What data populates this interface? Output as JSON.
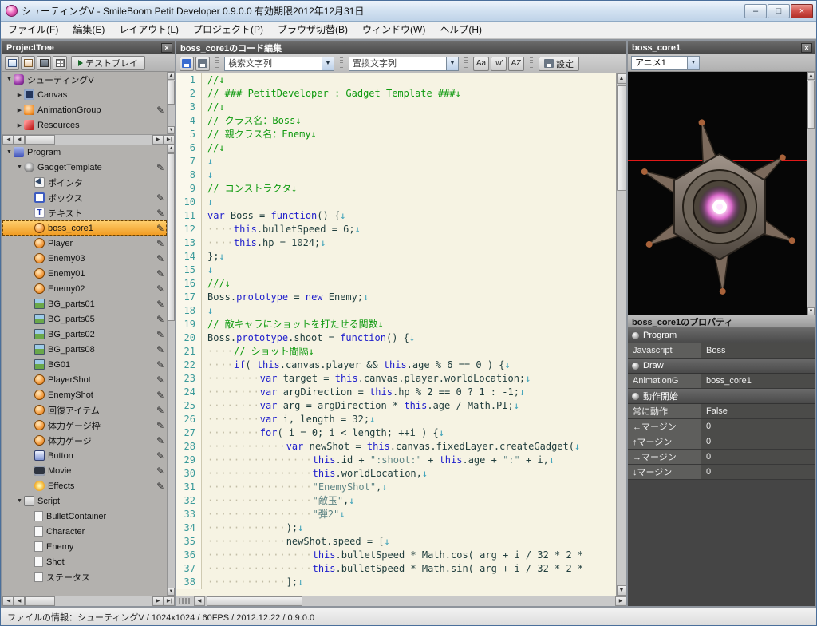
{
  "window": {
    "title": "シューティングV - SmileBoom Petit Developer 0.9.0.0 有効期限2012年12月31日",
    "controls": {
      "minimize": "–",
      "maximize": "□",
      "close": "×"
    }
  },
  "menu": {
    "items": [
      "ファイル(F)",
      "編集(E)",
      "レイアウト(L)",
      "プロジェクト(P)",
      "ブラウザ切替(B)",
      "ウィンドウ(W)",
      "ヘルプ(H)"
    ]
  },
  "project_tree": {
    "title": "ProjectTree",
    "testplay_label": "テストプレイ",
    "tree1": [
      {
        "label": "シューティングV",
        "icon": "app-icon",
        "depth": 0,
        "expander": "expanded"
      },
      {
        "label": "Canvas",
        "icon": "canvas-icon",
        "depth": 1,
        "expander": "collapsed"
      },
      {
        "label": "AnimationGroup",
        "icon": "animation-icon",
        "depth": 1,
        "expander": "collapsed",
        "pencil": true
      },
      {
        "label": "Resources",
        "icon": "resources-icon",
        "depth": 1,
        "expander": "collapsed"
      }
    ],
    "tree2": [
      {
        "label": "Program",
        "icon": "program-icon",
        "depth": 0,
        "expander": "expanded"
      },
      {
        "label": "GadgetTemplate",
        "icon": "gear-icon",
        "depth": 1,
        "expander": "expanded",
        "pencil": true
      },
      {
        "label": "ポインタ",
        "icon": "pointer-icon",
        "depth": 2
      },
      {
        "label": "ボックス",
        "icon": "box-icon",
        "depth": 2,
        "pencil": true
      },
      {
        "label": "テキスト",
        "icon": "text-icon",
        "depth": 2,
        "pencil": true
      },
      {
        "label": "boss_core1",
        "icon": "gadget-icon",
        "depth": 2,
        "pencil": true,
        "selected": true
      },
      {
        "label": "Player",
        "icon": "gadget-icon",
        "depth": 2,
        "pencil": true
      },
      {
        "label": "Enemy03",
        "icon": "gadget-icon",
        "depth": 2,
        "pencil": true
      },
      {
        "label": "Enemy01",
        "icon": "gadget-icon",
        "depth": 2,
        "pencil": true
      },
      {
        "label": "Enemy02",
        "icon": "gadget-icon",
        "depth": 2,
        "pencil": true
      },
      {
        "label": "BG_parts01",
        "icon": "image-icon",
        "depth": 2,
        "pencil": true
      },
      {
        "label": "BG_parts05",
        "icon": "image-icon",
        "depth": 2,
        "pencil": true
      },
      {
        "label": "BG_parts02",
        "icon": "image-icon",
        "depth": 2,
        "pencil": true
      },
      {
        "label": "BG_parts08",
        "icon": "image-icon",
        "depth": 2,
        "pencil": true
      },
      {
        "label": "BG01",
        "icon": "image-icon",
        "depth": 2,
        "pencil": true
      },
      {
        "label": "PlayerShot",
        "icon": "gadget-icon",
        "depth": 2,
        "pencil": true
      },
      {
        "label": "EnemyShot",
        "icon": "gadget-icon",
        "depth": 2,
        "pencil": true
      },
      {
        "label": "回復アイテム",
        "icon": "gadget-icon",
        "depth": 2,
        "pencil": true
      },
      {
        "label": "体力ゲージ枠",
        "icon": "gadget-icon",
        "depth": 2,
        "pencil": true
      },
      {
        "label": "体力ゲージ",
        "icon": "gadget-icon",
        "depth": 2,
        "pencil": true
      },
      {
        "label": "Button",
        "icon": "button-icon",
        "depth": 2,
        "pencil": true
      },
      {
        "label": "Movie",
        "icon": "movie-icon",
        "depth": 2,
        "pencil": true
      },
      {
        "label": "Effects",
        "icon": "effects-icon",
        "depth": 2,
        "pencil": true
      },
      {
        "label": "Script",
        "icon": "script-icon",
        "depth": 1,
        "expander": "expanded"
      },
      {
        "label": "BulletContainer",
        "icon": "page-icon",
        "depth": 2
      },
      {
        "label": "Character",
        "icon": "page-icon",
        "depth": 2
      },
      {
        "label": "Enemy",
        "icon": "page-icon",
        "depth": 2
      },
      {
        "label": "Shot",
        "icon": "page-icon",
        "depth": 2
      },
      {
        "label": "ステータス",
        "icon": "page-icon",
        "depth": 2
      }
    ]
  },
  "editor": {
    "title": "boss_core1のコード編集",
    "search_placeholder": "検索文字列",
    "replace_placeholder": "置換文字列",
    "buttons": {
      "case": "Aa",
      "word": "'w'",
      "regex": "AZ",
      "settings": "設定"
    },
    "lines": [
      [
        {
          "c": "cm",
          "t": "//↓"
        }
      ],
      [
        {
          "c": "cm",
          "t": "// ### PetitDeveloper : Gadget Template ###↓"
        }
      ],
      [
        {
          "c": "cm",
          "t": "//↓"
        }
      ],
      [
        {
          "c": "cm",
          "t": "// クラス名：Boss↓"
        }
      ],
      [
        {
          "c": "cm",
          "t": "// 親クラス名：Enemy↓"
        }
      ],
      [
        {
          "c": "cm",
          "t": "//↓"
        }
      ],
      [
        {
          "c": "nl",
          "t": "↓"
        }
      ],
      [
        {
          "c": "nl",
          "t": "↓"
        }
      ],
      [
        {
          "c": "cm",
          "t": "// コンストラクタ↓"
        }
      ],
      [
        {
          "c": "nl",
          "t": "↓"
        }
      ],
      [
        {
          "c": "kw",
          "t": "var"
        },
        {
          "c": "tx",
          "t": " Boss = "
        },
        {
          "c": "kw",
          "t": "function"
        },
        {
          "c": "tx",
          "t": "() {"
        },
        {
          "c": "nl",
          "t": "↓"
        }
      ],
      [
        {
          "c": "ws",
          "t": "····"
        },
        {
          "c": "kw",
          "t": "this"
        },
        {
          "c": "tx",
          "t": ".bulletSpeed = 6;"
        },
        {
          "c": "nl",
          "t": "↓"
        }
      ],
      [
        {
          "c": "ws",
          "t": "····"
        },
        {
          "c": "kw",
          "t": "this"
        },
        {
          "c": "tx",
          "t": ".hp = 1024;"
        },
        {
          "c": "nl",
          "t": "↓"
        }
      ],
      [
        {
          "c": "tx",
          "t": "};"
        },
        {
          "c": "nl",
          "t": "↓"
        }
      ],
      [
        {
          "c": "nl",
          "t": "↓"
        }
      ],
      [
        {
          "c": "cm",
          "t": "///↓"
        }
      ],
      [
        {
          "c": "tx",
          "t": "Boss."
        },
        {
          "c": "kw",
          "t": "prototype"
        },
        {
          "c": "tx",
          "t": " = "
        },
        {
          "c": "kw",
          "t": "new"
        },
        {
          "c": "tx",
          "t": " Enemy;"
        },
        {
          "c": "nl",
          "t": "↓"
        }
      ],
      [
        {
          "c": "nl",
          "t": "↓"
        }
      ],
      [
        {
          "c": "cm",
          "t": "// 敵キャラにショットを打たせる関数↓"
        }
      ],
      [
        {
          "c": "tx",
          "t": "Boss."
        },
        {
          "c": "kw",
          "t": "prototype"
        },
        {
          "c": "tx",
          "t": ".shoot = "
        },
        {
          "c": "kw",
          "t": "function"
        },
        {
          "c": "tx",
          "t": "() {"
        },
        {
          "c": "nl",
          "t": "↓"
        }
      ],
      [
        {
          "c": "ws",
          "t": "····"
        },
        {
          "c": "cm",
          "t": "// ショット間隔↓"
        }
      ],
      [
        {
          "c": "ws",
          "t": "····"
        },
        {
          "c": "kw",
          "t": "if"
        },
        {
          "c": "tx",
          "t": "( "
        },
        {
          "c": "kw",
          "t": "this"
        },
        {
          "c": "tx",
          "t": ".canvas.player && "
        },
        {
          "c": "kw",
          "t": "this"
        },
        {
          "c": "tx",
          "t": ".age % 6 == 0 ) {"
        },
        {
          "c": "nl",
          "t": "↓"
        }
      ],
      [
        {
          "c": "ws",
          "t": "········"
        },
        {
          "c": "kw",
          "t": "var"
        },
        {
          "c": "tx",
          "t": " target = "
        },
        {
          "c": "kw",
          "t": "this"
        },
        {
          "c": "tx",
          "t": ".canvas.player.worldLocation;"
        },
        {
          "c": "nl",
          "t": "↓"
        }
      ],
      [
        {
          "c": "ws",
          "t": "········"
        },
        {
          "c": "kw",
          "t": "var"
        },
        {
          "c": "tx",
          "t": " argDirection = "
        },
        {
          "c": "kw",
          "t": "this"
        },
        {
          "c": "tx",
          "t": ".hp % 2 == 0 ? 1 : -1;"
        },
        {
          "c": "nl",
          "t": "↓"
        }
      ],
      [
        {
          "c": "ws",
          "t": "········"
        },
        {
          "c": "kw",
          "t": "var"
        },
        {
          "c": "tx",
          "t": " arg = argDirection * "
        },
        {
          "c": "kw",
          "t": "this"
        },
        {
          "c": "tx",
          "t": ".age / Math.PI;"
        },
        {
          "c": "nl",
          "t": "↓"
        }
      ],
      [
        {
          "c": "ws",
          "t": "········"
        },
        {
          "c": "kw",
          "t": "var"
        },
        {
          "c": "tx",
          "t": " i, length = 32;"
        },
        {
          "c": "nl",
          "t": "↓"
        }
      ],
      [
        {
          "c": "ws",
          "t": "········"
        },
        {
          "c": "kw",
          "t": "for"
        },
        {
          "c": "tx",
          "t": "( i = 0; i < length; ++i ) {"
        },
        {
          "c": "nl",
          "t": "↓"
        }
      ],
      [
        {
          "c": "ws",
          "t": "············"
        },
        {
          "c": "kw",
          "t": "var"
        },
        {
          "c": "tx",
          "t": " newShot = "
        },
        {
          "c": "kw",
          "t": "this"
        },
        {
          "c": "tx",
          "t": ".canvas.fixedLayer.createGadget("
        },
        {
          "c": "nl",
          "t": "↓"
        }
      ],
      [
        {
          "c": "ws",
          "t": "················"
        },
        {
          "c": "kw",
          "t": "this"
        },
        {
          "c": "tx",
          "t": ".id + "
        },
        {
          "c": "st",
          "t": "\":shoot:\""
        },
        {
          "c": "tx",
          "t": " + "
        },
        {
          "c": "kw",
          "t": "this"
        },
        {
          "c": "tx",
          "t": ".age + "
        },
        {
          "c": "st",
          "t": "\":\""
        },
        {
          "c": "tx",
          "t": " + i,"
        },
        {
          "c": "nl",
          "t": "↓"
        }
      ],
      [
        {
          "c": "ws",
          "t": "················"
        },
        {
          "c": "kw",
          "t": "this"
        },
        {
          "c": "tx",
          "t": ".worldLocation,"
        },
        {
          "c": "nl",
          "t": "↓"
        }
      ],
      [
        {
          "c": "ws",
          "t": "················"
        },
        {
          "c": "st",
          "t": "\"EnemyShot\""
        },
        {
          "c": "tx",
          "t": ","
        },
        {
          "c": "nl",
          "t": "↓"
        }
      ],
      [
        {
          "c": "ws",
          "t": "················"
        },
        {
          "c": "st",
          "t": "\"敵玉\""
        },
        {
          "c": "tx",
          "t": ","
        },
        {
          "c": "nl",
          "t": "↓"
        }
      ],
      [
        {
          "c": "ws",
          "t": "················"
        },
        {
          "c": "st",
          "t": "\"弾2\""
        },
        {
          "c": "nl",
          "t": "↓"
        }
      ],
      [
        {
          "c": "ws",
          "t": "············"
        },
        {
          "c": "tx",
          "t": ");"
        },
        {
          "c": "nl",
          "t": "↓"
        }
      ],
      [
        {
          "c": "ws",
          "t": "············"
        },
        {
          "c": "tx",
          "t": "newShot.speed = ["
        },
        {
          "c": "nl",
          "t": "↓"
        }
      ],
      [
        {
          "c": "ws",
          "t": "················"
        },
        {
          "c": "kw",
          "t": "this"
        },
        {
          "c": "tx",
          "t": ".bulletSpeed * Math.cos( arg + i / 32 * 2 *"
        }
      ],
      [
        {
          "c": "ws",
          "t": "················"
        },
        {
          "c": "kw",
          "t": "this"
        },
        {
          "c": "tx",
          "t": ".bulletSpeed * Math.sin( arg + i / 32 * 2 *"
        }
      ],
      [
        {
          "c": "ws",
          "t": "············"
        },
        {
          "c": "tx",
          "t": "];"
        },
        {
          "c": "nl",
          "t": "↓"
        }
      ]
    ]
  },
  "preview": {
    "title": "boss_core1",
    "anim_select": "アニメ1"
  },
  "properties": {
    "title": "boss_core1のプロパティ",
    "rows": [
      {
        "type": "group",
        "label": "Program"
      },
      {
        "type": "prop",
        "label": "Javascript",
        "value": "Boss"
      },
      {
        "type": "group",
        "label": "Draw"
      },
      {
        "type": "prop",
        "label": "AnimationG",
        "value": "boss_core1"
      },
      {
        "type": "group",
        "label": "動作開始"
      },
      {
        "type": "prop",
        "label": "常に動作",
        "value": "False"
      },
      {
        "type": "prop",
        "label": "←マージン",
        "value": "0"
      },
      {
        "type": "prop",
        "label": "↑マージン",
        "value": "0"
      },
      {
        "type": "prop",
        "label": "→マージン",
        "value": "0"
      },
      {
        "type": "prop",
        "label": "↓マージン",
        "value": "0"
      }
    ]
  },
  "status_bar": {
    "text": "ファイルの情報：シューティングV / 1024x1024 / 60FPS / 2012.12.22 / 0.9.0.0"
  }
}
